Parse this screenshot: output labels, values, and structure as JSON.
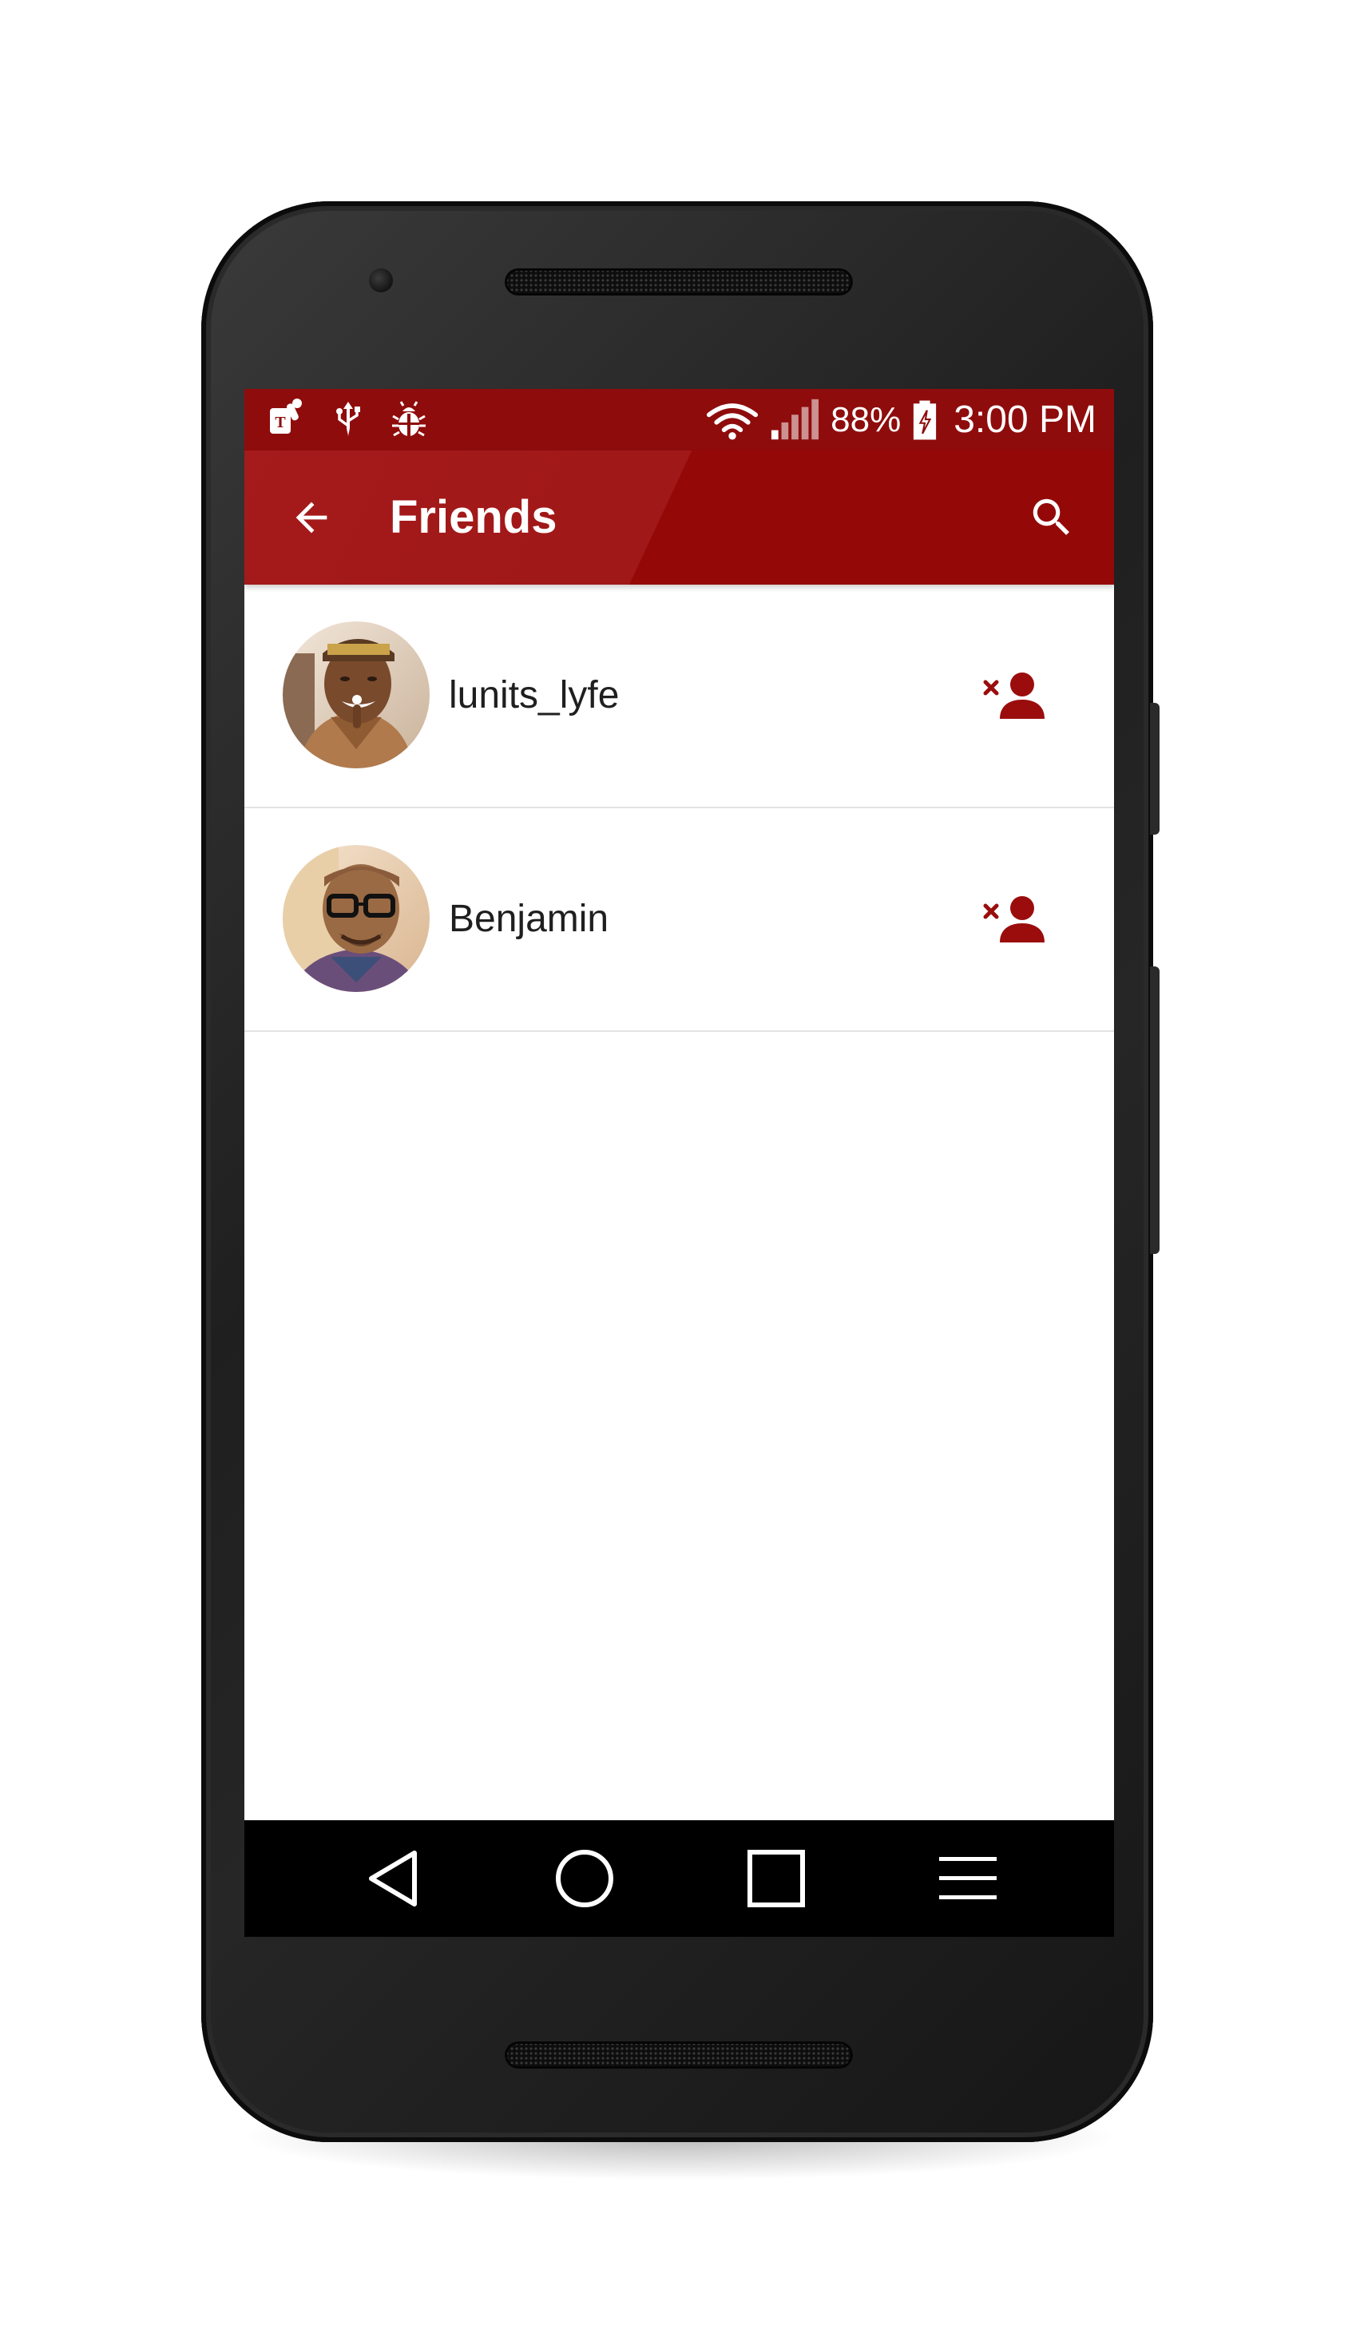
{
  "status_bar": {
    "left_icons": [
      "tmobile-notification-icon",
      "usb-icon",
      "debug-bug-icon"
    ],
    "battery_percent": "88%",
    "time": "3:00 PM",
    "right_icons": [
      "wifi-icon",
      "cell-signal-icon",
      "battery-charging-icon"
    ]
  },
  "app_bar": {
    "title": "Friends",
    "back_icon": "arrow-back-icon",
    "search_icon": "search-icon"
  },
  "friends": [
    {
      "name": "lunits_lyfe",
      "action_icon": "remove-friend-icon"
    },
    {
      "name": "Benjamin",
      "action_icon": "remove-friend-icon"
    }
  ],
  "nav_bar": {
    "buttons": [
      "back-triangle-icon",
      "home-circle-icon",
      "recents-square-icon",
      "menu-icon"
    ]
  },
  "colors": {
    "status_bar": "#8f0c0c",
    "app_bar": "#a01818",
    "accent": "#9b0d0d",
    "nav_bar": "#000000"
  }
}
